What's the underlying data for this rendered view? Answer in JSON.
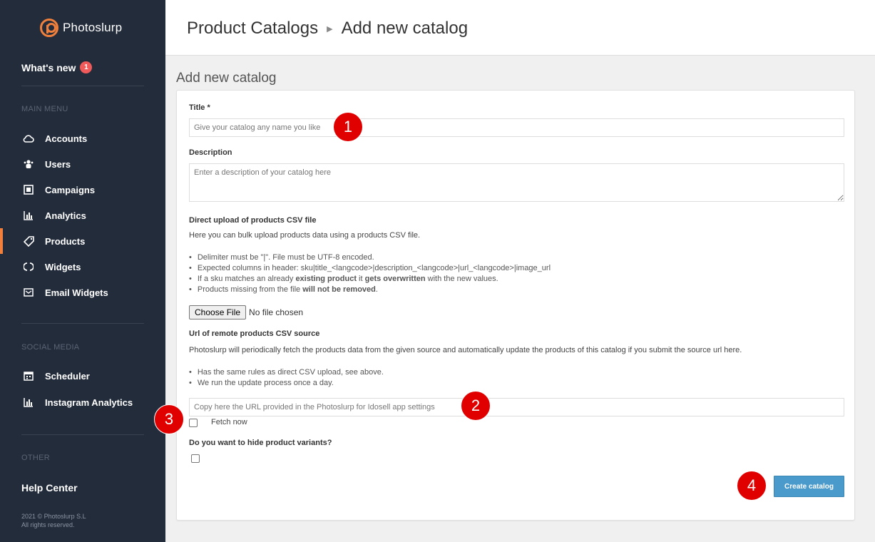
{
  "brand": {
    "name": "Photoslurp",
    "accent": "#f0803c"
  },
  "sidebar": {
    "whats_new": "What's new",
    "whats_new_count": "1",
    "main_menu_label": "MAIN MENU",
    "main_items": [
      {
        "label": "Accounts",
        "icon": "cloud-icon"
      },
      {
        "label": "Users",
        "icon": "users-icon"
      },
      {
        "label": "Campaigns",
        "icon": "campaigns-icon"
      },
      {
        "label": "Analytics",
        "icon": "bar-chart-icon"
      },
      {
        "label": "Products",
        "icon": "tag-icon",
        "active": true
      },
      {
        "label": "Widgets",
        "icon": "widgets-icon"
      },
      {
        "label": "Email Widgets",
        "icon": "email-icon"
      }
    ],
    "social_label": "SOCIAL MEDIA",
    "social_items": [
      {
        "label": "Scheduler",
        "icon": "calendar-icon"
      },
      {
        "label": "Instagram Analytics",
        "icon": "bar-chart-icon"
      }
    ],
    "other_label": "OTHER",
    "help_center": "Help Center",
    "copyright_line1": "2021 © Photoslurp S.L",
    "copyright_line2": "All rights reserved."
  },
  "header": {
    "breadcrumb_parent": "Product Catalogs",
    "breadcrumb_current": "Add new catalog"
  },
  "main": {
    "heading": "Add new catalog",
    "title_label": "Title *",
    "title_placeholder": "Give your catalog any name you like",
    "description_label": "Description",
    "description_placeholder": "Enter a description of your catalog here",
    "upload_heading": "Direct upload of products CSV file",
    "upload_intro": "Here you can bulk upload products data using a products CSV file.",
    "upload_rules": [
      {
        "pre": "Delimiter must be \"|\". File must be UTF-8 encoded.",
        "bold": "",
        "post": "",
        "bold2": "",
        "post2": ""
      },
      {
        "pre": "Expected columns in header: sku|title_<langcode>|description_<langcode>|url_<langcode>|image_url",
        "bold": "",
        "post": "",
        "bold2": "",
        "post2": ""
      },
      {
        "pre": "If a sku matches an already ",
        "bold": "existing product",
        "post": " it ",
        "bold2": "gets overwritten",
        "post2": " with the new values."
      },
      {
        "pre": "Products missing from the file ",
        "bold": "will not be removed",
        "post": ".",
        "bold2": "",
        "post2": ""
      }
    ],
    "choose_file": "Choose File",
    "no_file": "No file chosen",
    "remote_heading": "Url of remote products CSV source",
    "remote_intro": "Photoslurp will periodically fetch the products data from the given source and automatically update the products of this catalog if you submit the source url here.",
    "remote_rules": [
      "Has the same rules as direct CSV upload, see above.",
      "We run the update process once a day."
    ],
    "remote_placeholder": "Copy here the URL provided in the Photoslurp for Idosell app settings",
    "fetch_now": "Fetch now",
    "variants_label": "Do you want to hide product variants?",
    "create_button": "Create catalog"
  },
  "markers": [
    "1",
    "2",
    "3",
    "4"
  ]
}
